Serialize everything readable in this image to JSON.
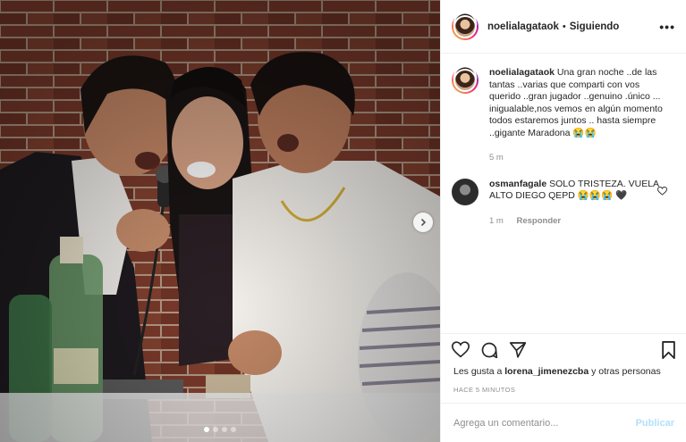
{
  "photo": {
    "alt_colors": {
      "wall": "#7a3b2c",
      "mortar": "#b9a08a"
    },
    "dots_count": 4,
    "active_dot": 0
  },
  "header": {
    "username": "noelialagataok",
    "separator": "•",
    "follow_status": "Siguiendo",
    "more": "•••"
  },
  "caption": {
    "username": "noelialagataok",
    "text": "Una gran noche ..de las tantas ..varias que comparti con vos querido ..gran jugador ..genuino .único ... inigualable,nos vemos en algún momento todos estaremos juntos .. hasta siempre ..gigante Maradona 😭😭",
    "time": "5 m"
  },
  "comment": {
    "username": "osmanfagale",
    "text": "SOLO TRISTEZA. VUELA ALTO DIEGO QEPD 😭😭😭 🖤",
    "time": "1 m",
    "reply": "Responder"
  },
  "likes": {
    "prefix": "Les gusta a",
    "user": "lorena_jimenezcba",
    "suffix": "y otras personas"
  },
  "post_time": "HACE 5 MINUTOS",
  "add_comment": {
    "placeholder": "Agrega un comentario...",
    "publish": "Publicar"
  },
  "icons": [
    "heart-icon",
    "comment-icon",
    "share-icon",
    "bookmark-icon",
    "chevron-right-icon",
    "more-icon"
  ]
}
